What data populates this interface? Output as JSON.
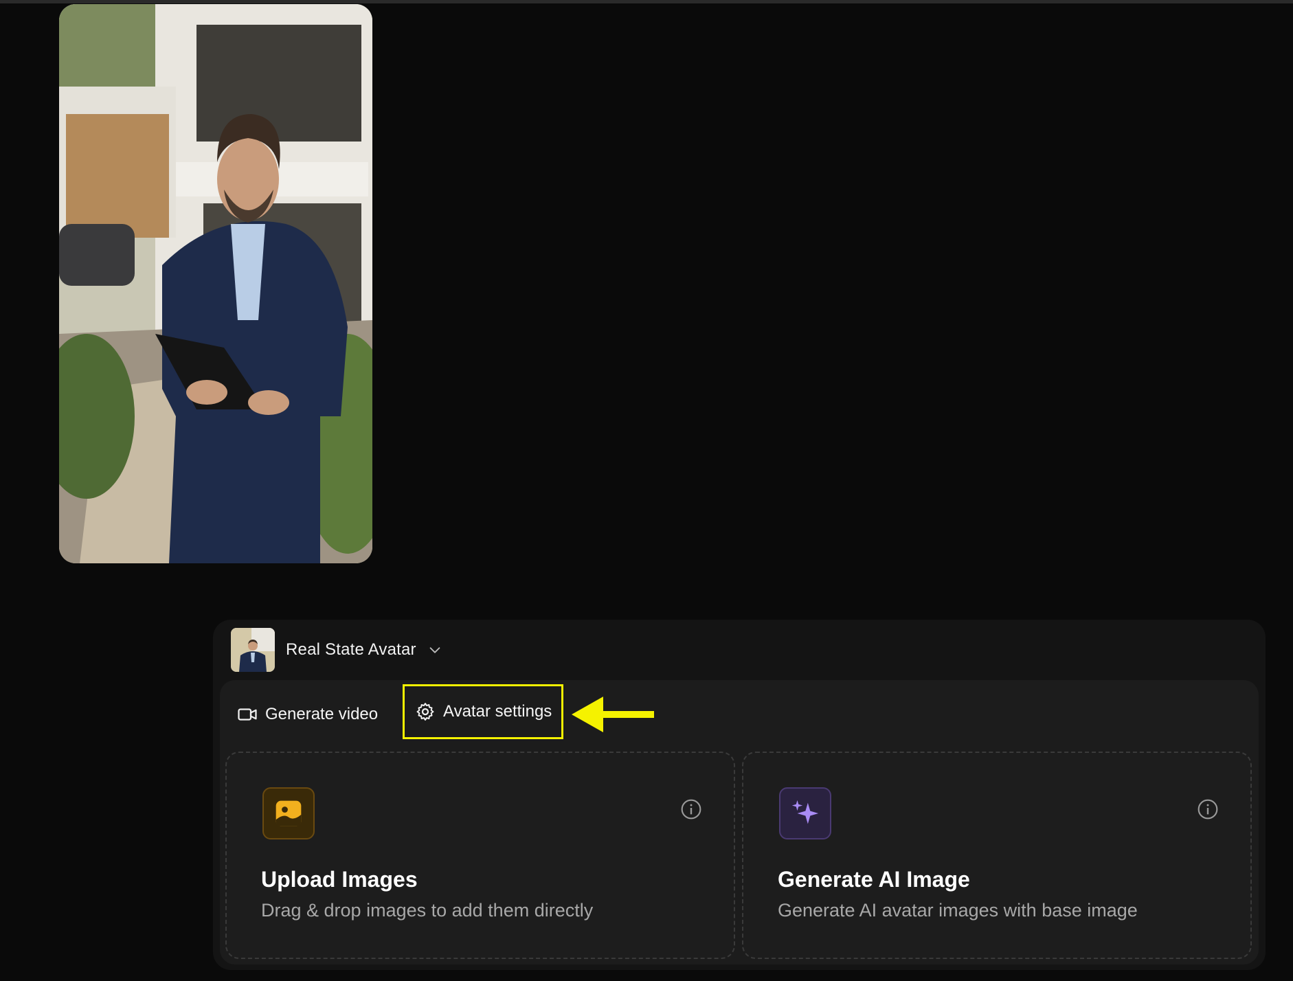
{
  "avatar": {
    "name": "Real State Avatar"
  },
  "tabs": {
    "generate_video": "Generate video",
    "avatar_settings": "Avatar settings"
  },
  "cards": {
    "upload": {
      "title": "Upload Images",
      "description": "Drag & drop images to add them directly",
      "icon": "image-upload-icon"
    },
    "generate": {
      "title": "Generate AI Image",
      "description": "Generate AI avatar images with base image",
      "icon": "sparkles-icon"
    }
  },
  "colors": {
    "background": "#0a0a0a",
    "highlight": "#f5f200",
    "upload_accent": "#f2b01e",
    "generate_accent": "#a98cf5"
  }
}
